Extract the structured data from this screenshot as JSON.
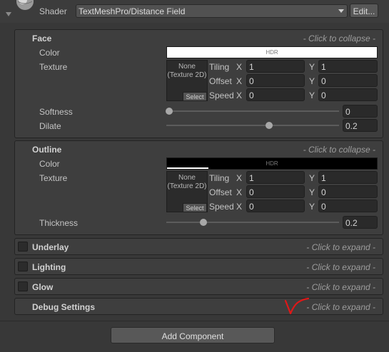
{
  "header": {
    "shader_label": "Shader",
    "shader_value": "TextMeshPro/Distance Field",
    "edit_label": "Edit..."
  },
  "face": {
    "title": "Face",
    "hint": "- Click to collapse -",
    "color_label": "Color",
    "color_value": "#ffffff",
    "hdr": "HDR",
    "texture_label": "Texture",
    "texture_none": "None (Texture 2D)",
    "select": "Select",
    "tiling_label": "Tiling",
    "offset_label": "Offset",
    "speed_label": "Speed",
    "x": "X",
    "y": "Y",
    "tiling_x": "1",
    "tiling_y": "1",
    "offset_x": "0",
    "offset_y": "0",
    "speed_x": "0",
    "speed_y": "0",
    "softness_label": "Softness",
    "softness_value": "0",
    "dilate_label": "Dilate",
    "dilate_value": "0.2"
  },
  "outline": {
    "title": "Outline",
    "hint": "- Click to collapse -",
    "color_label": "Color",
    "color_value": "#000000",
    "hdr": "HDR",
    "texture_label": "Texture",
    "texture_none": "None (Texture 2D)",
    "select": "Select",
    "tiling_label": "Tiling",
    "offset_label": "Offset",
    "speed_label": "Speed",
    "x": "X",
    "y": "Y",
    "tiling_x": "1",
    "tiling_y": "1",
    "offset_x": "0",
    "offset_y": "0",
    "speed_x": "0",
    "speed_y": "0",
    "thickness_label": "Thickness",
    "thickness_value": "0.2"
  },
  "collapsed": {
    "underlay": "Underlay",
    "lighting": "Lighting",
    "glow": "Glow",
    "debug": "Debug Settings",
    "expand_hint": "- Click to expand -"
  },
  "footer": {
    "add_component": "Add Component"
  },
  "colors": {
    "panel_bg": "#383838",
    "section_bg": "#3e3e3e",
    "field_bg": "#2a2a2a",
    "annotation": "#e01818"
  },
  "icons": {
    "thumbnail": "shader-sphere-icon",
    "dropdown": "chevron-down-icon",
    "foldout": "foldout-arrow-icon",
    "annotation": "checkmark-scribble-icon"
  }
}
